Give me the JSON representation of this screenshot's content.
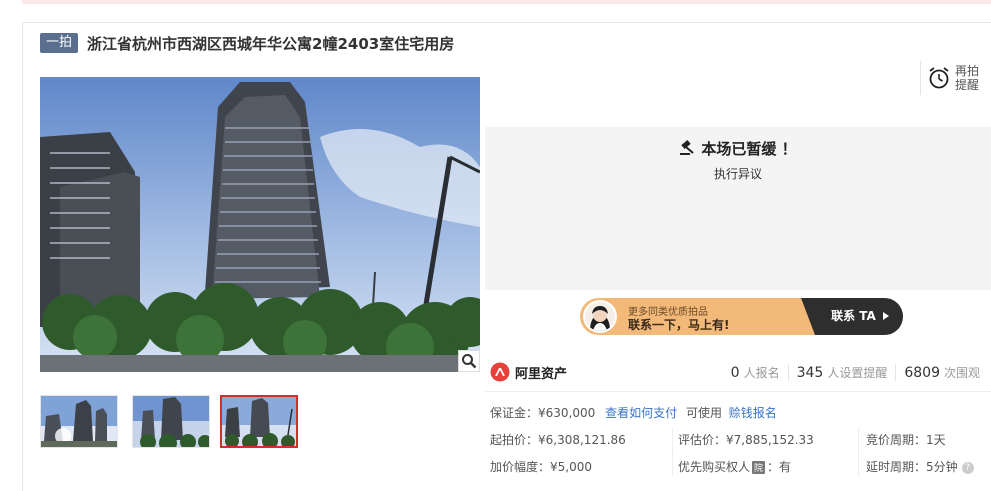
{
  "header": {
    "badge": "一拍",
    "title": "浙江省杭州市西湖区西城年华公寓2幢2403室住宅用房"
  },
  "remind": {
    "label": "再拍提醒"
  },
  "status": {
    "title": "本场已暂缓 ！",
    "subtitle": "执行异议"
  },
  "contact_banner": {
    "line1": "更多同类优质拍品",
    "line2": "联系一下，马上有!",
    "cta": "联系 TA"
  },
  "brand": {
    "name": "阿里资产"
  },
  "stats": [
    {
      "value": "0",
      "label": "人报名"
    },
    {
      "value": "345",
      "label": "人设置提醒"
    },
    {
      "value": "6809",
      "label": "次围观"
    }
  ],
  "deposit": {
    "label": "保证金：¥630,000",
    "pay_link": "查看如何支付",
    "usable": "可使用",
    "loan_link": "赊钱报名"
  },
  "details": {
    "start_price": "起拍价：¥6,308,121.86",
    "appraisal": "评估价：¥7,885,152.33",
    "period": "竞价周期：1天",
    "increment": "加价幅度：¥5,000",
    "priority_label": "优先购买权人",
    "priority_tag": "院",
    "priority_value": "：有",
    "delay": "延时周期：5分钟"
  },
  "colors": {
    "badge": "#5a6e8f",
    "link": "#3a74c4",
    "active_thumb_border": "#d12f2f",
    "banner_orange": "#f3b978",
    "banner_dark": "#2e2e2e",
    "brand_red": "#e8403a"
  },
  "icons": {
    "remind": "alarm-clock-icon",
    "status": "gavel-icon",
    "zoom": "magnifier-icon",
    "brand": "ali-assets-logo-icon",
    "help": "question-icon"
  }
}
